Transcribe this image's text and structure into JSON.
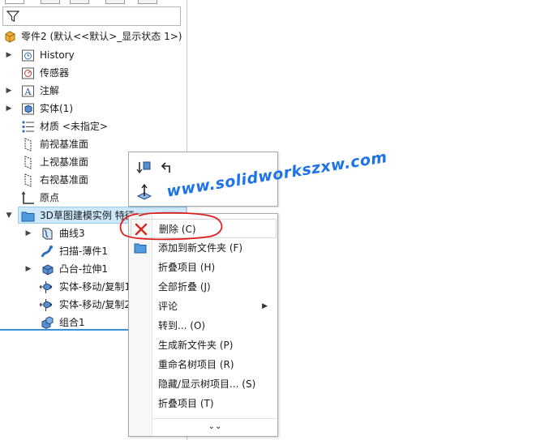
{
  "colors": {
    "selection_bg": "#cde8fb",
    "selection_border": "#99cdf0",
    "accent_line": "#3d8fd6",
    "annotation_red": "#e01d1d",
    "watermark_blue": "#1e73e8",
    "delete_red": "#d9261c"
  },
  "tabs": [
    {
      "icon": "feature-manager-icon"
    },
    {
      "icon": "property-manager-icon"
    },
    {
      "icon": "configuration-manager-icon"
    },
    {
      "icon": "dimxpert-icon"
    },
    {
      "icon": "display-manager-icon"
    }
  ],
  "filter": {
    "icon": "filter-icon"
  },
  "tree": {
    "root": "零件2 (默认<<默认>_显示状态 1>)",
    "items": [
      {
        "label": "History",
        "icon": "history-icon",
        "expandable": true
      },
      {
        "label": "传感器",
        "icon": "sensor-icon",
        "expandable": false
      },
      {
        "label": "注解",
        "icon": "annotation-icon",
        "expandable": true
      },
      {
        "label": "实体(1)",
        "icon": "solid-bodies-icon",
        "expandable": true
      },
      {
        "label": "材质 <未指定>",
        "icon": "material-icon",
        "expandable": false
      },
      {
        "label": "前视基准面",
        "icon": "plane-icon",
        "expandable": false
      },
      {
        "label": "上视基准面",
        "icon": "plane-icon",
        "expandable": false
      },
      {
        "label": "右视基准面",
        "icon": "plane-icon",
        "expandable": false
      },
      {
        "label": "原点",
        "icon": "origin-icon",
        "expandable": false
      },
      {
        "label": "3D草图建模实例 特征",
        "icon": "folder-icon",
        "expandable": true,
        "expanded": true,
        "selected": true
      },
      {
        "label": "曲线3",
        "icon": "curve-icon",
        "expandable": true,
        "child": true
      },
      {
        "label": "扫描-薄件1",
        "icon": "sweep-icon",
        "expandable": false,
        "child": true
      },
      {
        "label": "凸台-拉伸1",
        "icon": "boss-extrude-icon",
        "expandable": true,
        "child": true
      },
      {
        "label": "实体-移动/复制1",
        "icon": "move-copy-icon",
        "expandable": false,
        "child": true
      },
      {
        "label": "实体-移动/复制2",
        "icon": "move-copy-icon",
        "expandable": false,
        "child": true
      },
      {
        "label": "组合1",
        "icon": "combine-icon",
        "expandable": false,
        "child": true
      }
    ]
  },
  "toolbar": {
    "buttons": [
      {
        "icon": "rollback-icon"
      },
      {
        "icon": "undo-arrow-icon"
      },
      {
        "icon": "normal-to-icon"
      }
    ]
  },
  "context_menu": {
    "items": [
      {
        "label": "删除 (C)",
        "icon": "delete-x-icon"
      },
      {
        "label": "添加到新文件夹 (F)",
        "icon": "folder-icon"
      },
      {
        "label": "折叠项目 (H)"
      },
      {
        "label": "全部折叠 (J)"
      },
      {
        "label": "评论",
        "submenu": true
      },
      {
        "label": "转到... (O)"
      },
      {
        "label": "生成新文件夹 (P)"
      },
      {
        "label": "重命名树项目 (R)"
      },
      {
        "label": "隐藏/显示树项目... (S)"
      },
      {
        "label": "折叠项目 (T)"
      }
    ],
    "more_glyph": "⌄⌄"
  },
  "watermark": "www.solidworkszxw.com"
}
